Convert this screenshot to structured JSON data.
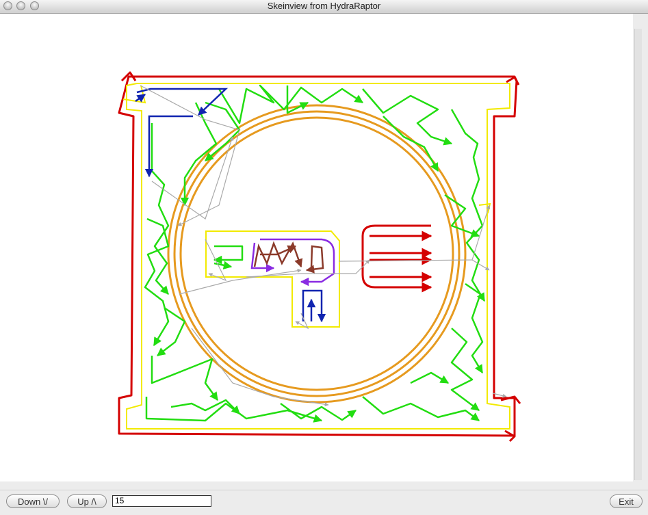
{
  "window": {
    "title": "Skeinview from HydraRaptor"
  },
  "controls": {
    "down_label": "Down \\/",
    "up_label": "Up /\\",
    "layer_value": "15",
    "exit_label": "Exit"
  },
  "colors": {
    "outline_red": "#d40000",
    "perimeter_yellow": "#f2ea00",
    "infill_green": "#22dd11",
    "ring_orange": "#e69a1f",
    "travel_gray": "#a9a9a9",
    "blue": "#1024b0",
    "purple": "#8a2be2",
    "brown": "#8b3a2a"
  }
}
